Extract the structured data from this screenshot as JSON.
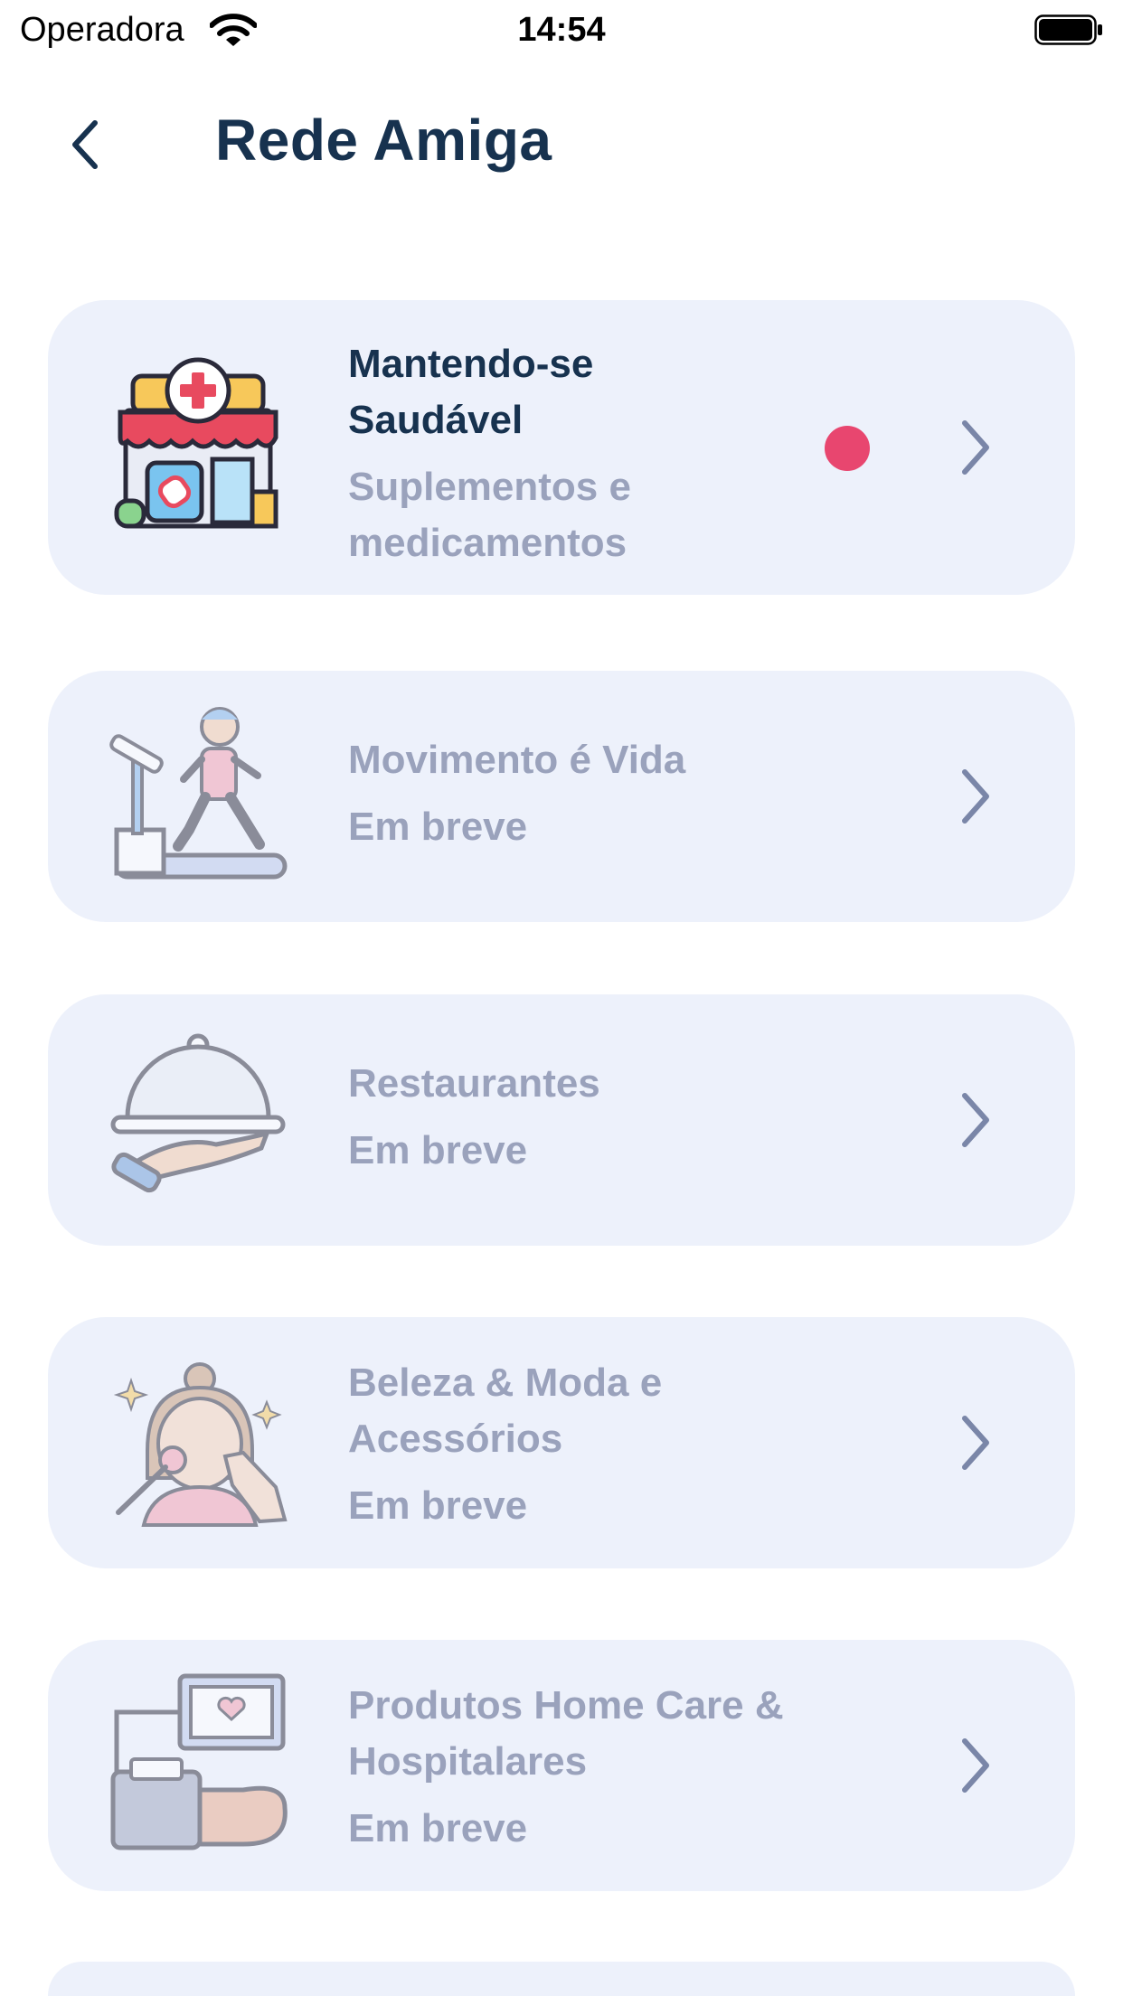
{
  "status_bar": {
    "carrier": "Operadora",
    "time": "14:54"
  },
  "header": {
    "title": "Rede Amiga"
  },
  "cards": [
    {
      "title_lines": [
        "Mantendo-se",
        "Saudável"
      ],
      "subtitle_lines": [
        "Suplementos e",
        "medicamentos"
      ],
      "icon": "pharmacy-store-icon",
      "has_notification": true,
      "enabled": true
    },
    {
      "title_lines": [
        "Movimento é Vida"
      ],
      "subtitle_lines": [
        "Em breve"
      ],
      "icon": "treadmill-runner-icon",
      "enabled": false
    },
    {
      "title_lines": [
        "Restaurantes"
      ],
      "subtitle_lines": [
        "Em breve"
      ],
      "icon": "food-cloche-icon",
      "enabled": false
    },
    {
      "title_lines": [
        "Beleza & Moda e",
        "Acessórios"
      ],
      "subtitle_lines": [
        "Em breve"
      ],
      "icon": "beauty-makeup-icon",
      "enabled": false
    },
    {
      "title_lines": [
        "Produtos Home Care &",
        "Hospitalares"
      ],
      "subtitle_lines": [
        "Em breve"
      ],
      "icon": "blood-pressure-monitor-icon",
      "enabled": false
    }
  ],
  "colors": {
    "navy": "#17324f",
    "card_bg": "#edf1fb",
    "muted_text": "#9aa2bc",
    "chevron": "#7a86a8",
    "notification_dot": "#e8466f"
  }
}
